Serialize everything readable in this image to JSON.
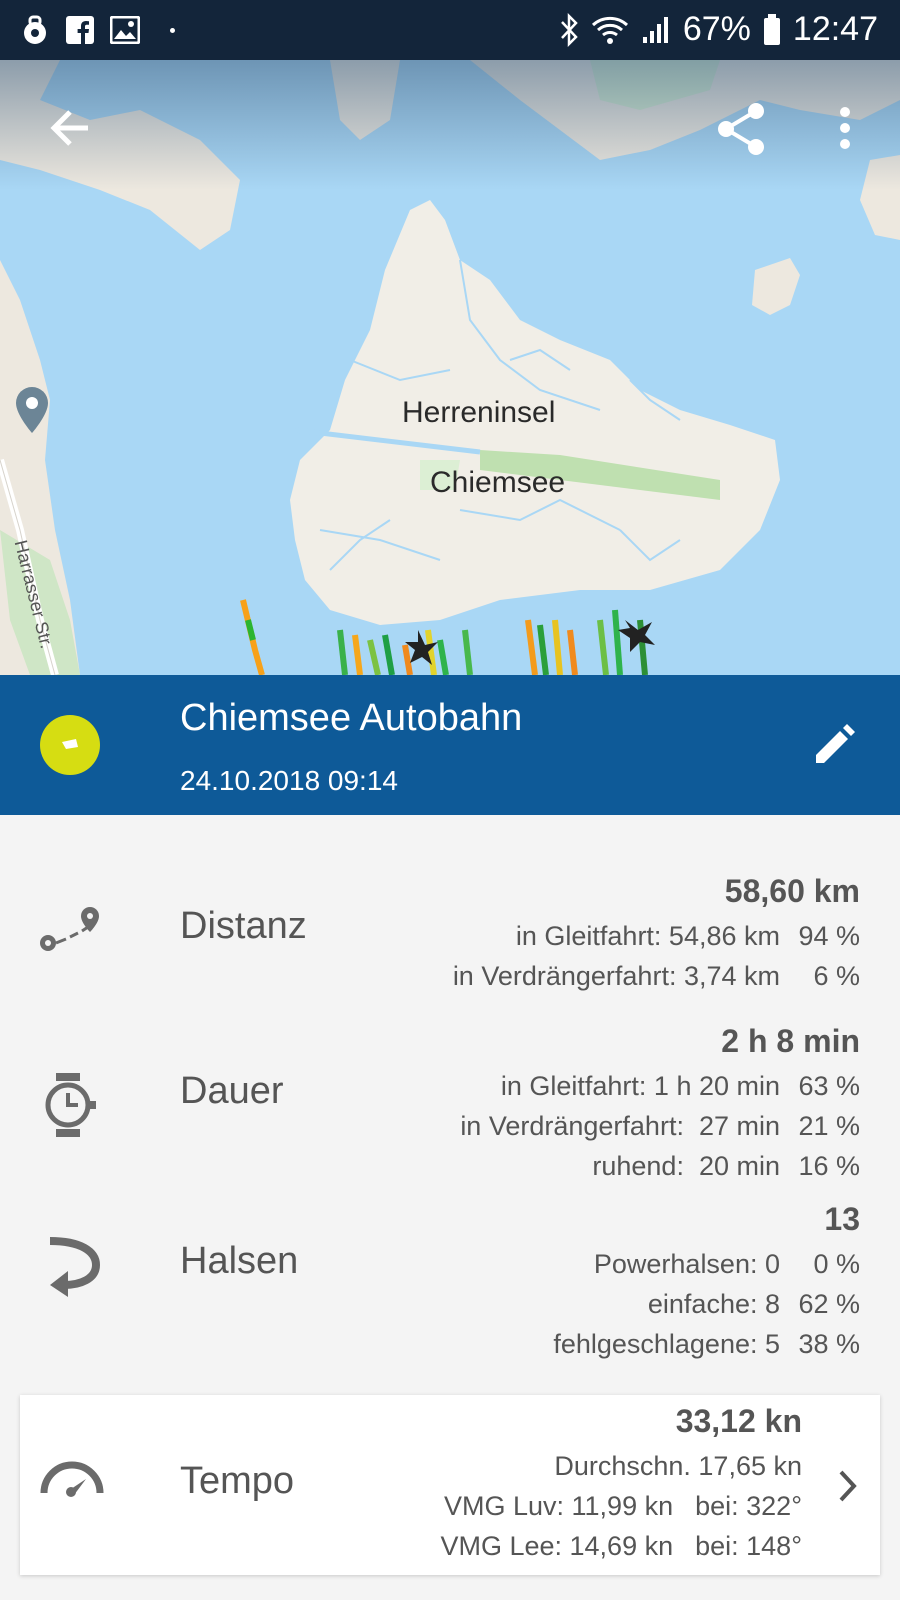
{
  "status_bar": {
    "battery": "67%",
    "time": "12:47"
  },
  "map": {
    "island_label": "Herreninsel",
    "lake_label": "Chiemsee",
    "street_label": "Harrasser Str."
  },
  "session": {
    "title": "Chiemsee Autobahn",
    "datetime": "24.10.2018 09:14"
  },
  "stats": {
    "distance": {
      "label": "Distanz",
      "total": "58,60 km",
      "rows": [
        {
          "text": "in Gleitfahrt: 54,86 km",
          "pct": "94 %"
        },
        {
          "text": "in Verdrängerfahrt: 3,74 km",
          "pct": "6 %"
        }
      ]
    },
    "duration": {
      "label": "Dauer",
      "total": "2 h 8 min",
      "rows": [
        {
          "text": "in Gleitfahrt: 1 h 20 min",
          "pct": "63 %"
        },
        {
          "text": "in Verdrängerfahrt:  27 min",
          "pct": "21 %"
        },
        {
          "text": "ruhend:  20 min",
          "pct": "16 %"
        }
      ]
    },
    "jibes": {
      "label": "Halsen",
      "total": "13",
      "rows": [
        {
          "text": "Powerhalsen: 0",
          "pct": "0 %"
        },
        {
          "text": "einfache: 8",
          "pct": "62 %"
        },
        {
          "text": "fehlgeschlagene: 5",
          "pct": "38 %"
        }
      ]
    },
    "speed": {
      "label": "Tempo",
      "total": "33,12 kn",
      "avg": "Durchschn. 17,65 kn",
      "rows": [
        {
          "text": "VMG Luv: 11,99 kn",
          "bei": "bei: 322°"
        },
        {
          "text": "VMG Lee: 14,69 kn",
          "bei": "bei: 148°"
        }
      ]
    }
  },
  "colors": {
    "header_bg": "#0e5a98",
    "status_bg": "#13253a",
    "badge": "#d6dd12",
    "water": "#a9d7f5"
  },
  "icons": [
    "back-arrow-icon",
    "share-icon",
    "more-vert-icon",
    "edit-pencil-icon",
    "route-icon",
    "stopwatch-icon",
    "u-turn-icon",
    "speedometer-icon",
    "chevron-right-icon"
  ]
}
